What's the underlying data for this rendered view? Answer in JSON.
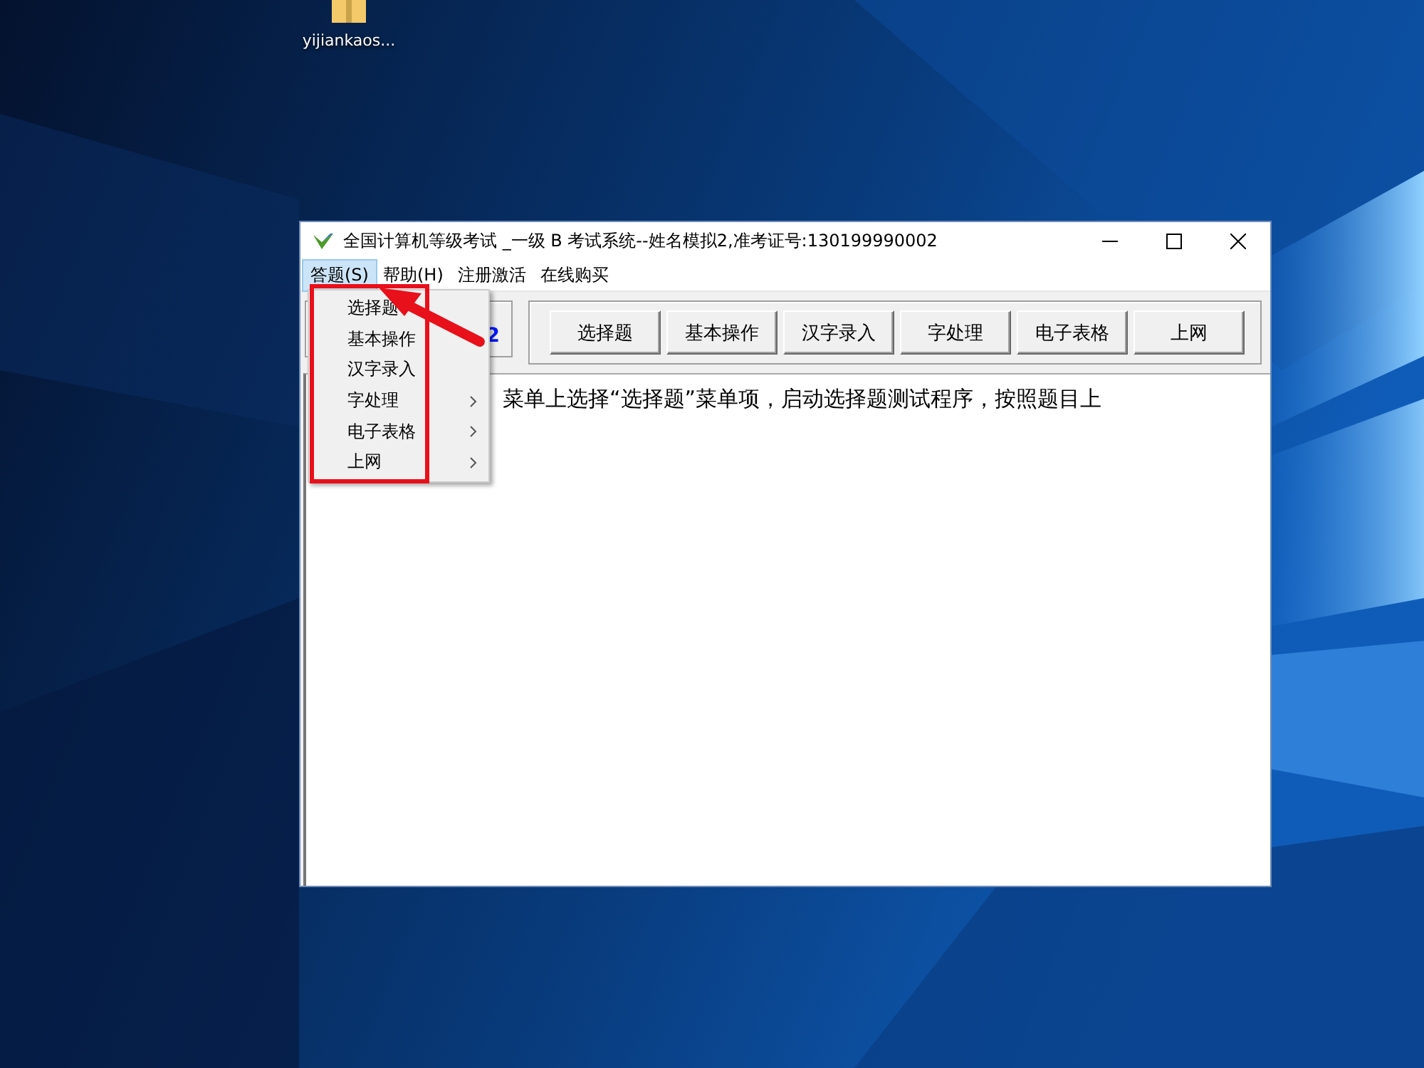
{
  "desktop_icons": [
    {
      "label": "yijiankaos..."
    }
  ],
  "window": {
    "title": "全国计算机等级考试 _一级 B 考试系统--姓名模拟2,准考证号:130199990002"
  },
  "menu_bar": [
    {
      "label": "答题(S)",
      "selected": true
    },
    {
      "label": "帮助(H)",
      "selected": false
    },
    {
      "label": "注册激活",
      "selected": false
    },
    {
      "label": "在线购买",
      "selected": false
    }
  ],
  "timer": {
    "text": "2"
  },
  "toolbar_buttons": [
    "选择题",
    "基本操作",
    "汉字录入",
    "字处理",
    "电子表格",
    "上网"
  ],
  "content": {
    "text": "菜单上选择“选择题”菜单项，启动选择题测试程序，按照题目上"
  },
  "dropdown": [
    {
      "label": "选择题",
      "has_submenu": false
    },
    {
      "label": "基本操作",
      "has_submenu": false
    },
    {
      "label": "汉字录入",
      "has_submenu": false
    },
    {
      "label": "字处理",
      "has_submenu": true
    },
    {
      "label": "电子表格",
      "has_submenu": true
    },
    {
      "label": "上网",
      "has_submenu": true
    }
  ]
}
